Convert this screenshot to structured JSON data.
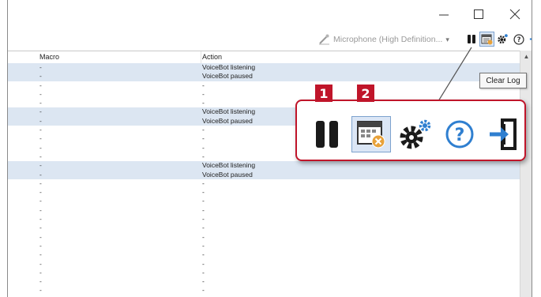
{
  "window": {
    "minimize_icon": "minimize-icon",
    "maximize_icon": "maximize-icon",
    "close_icon": "close-icon"
  },
  "toolbar": {
    "microphone_label": "Microphone (High Definition...",
    "caret": "▾",
    "icons": [
      "pause-icon",
      "clear-log-icon",
      "settings-icon",
      "help-icon",
      "exit-icon"
    ]
  },
  "tooltip": {
    "text": "Clear Log"
  },
  "grid": {
    "columns": {
      "macro": "Macro",
      "action": "Action"
    },
    "rows": [
      {
        "macro": "-",
        "action": "VoiceBot listening",
        "alt": true
      },
      {
        "macro": "-",
        "action": "VoiceBot paused",
        "alt": true
      },
      {
        "macro": "-",
        "action": "-",
        "alt": false
      },
      {
        "macro": "-",
        "action": "-",
        "alt": false
      },
      {
        "macro": "-",
        "action": "-",
        "alt": false
      },
      {
        "macro": "-",
        "action": "VoiceBot listening",
        "alt": true
      },
      {
        "macro": "-",
        "action": "VoiceBot paused",
        "alt": true
      },
      {
        "macro": "-",
        "action": "-",
        "alt": false
      },
      {
        "macro": "-",
        "action": "-",
        "alt": false
      },
      {
        "macro": "-",
        "action": "-",
        "alt": false
      },
      {
        "macro": "-",
        "action": "-",
        "alt": false
      },
      {
        "macro": "-",
        "action": "VoiceBot listening",
        "alt": true
      },
      {
        "macro": "-",
        "action": "VoiceBot paused",
        "alt": true
      },
      {
        "macro": "-",
        "action": "-",
        "alt": false
      },
      {
        "macro": "-",
        "action": "-",
        "alt": false
      },
      {
        "macro": "-",
        "action": "-",
        "alt": false
      },
      {
        "macro": "-",
        "action": "-",
        "alt": false
      },
      {
        "macro": "-",
        "action": "-",
        "alt": false
      },
      {
        "macro": "-",
        "action": "-",
        "alt": false
      },
      {
        "macro": "-",
        "action": "-",
        "alt": false
      },
      {
        "macro": "-",
        "action": "-",
        "alt": false
      },
      {
        "macro": "-",
        "action": "-",
        "alt": false
      },
      {
        "macro": "-",
        "action": "-",
        "alt": false
      },
      {
        "macro": "-",
        "action": "-",
        "alt": false
      },
      {
        "macro": "-",
        "action": "-",
        "alt": false
      },
      {
        "macro": "-",
        "action": "-",
        "alt": false
      }
    ]
  },
  "callout": {
    "badge_1": "1",
    "badge_2": "2",
    "icons": [
      "pause-icon",
      "clear-log-icon",
      "settings-icon",
      "help-icon",
      "exit-icon"
    ],
    "border_color": "#c0152a"
  },
  "colors": {
    "accent_red": "#c0152a",
    "row_highlight": "#dce6f2",
    "icon_blue": "#2f7fd0"
  }
}
